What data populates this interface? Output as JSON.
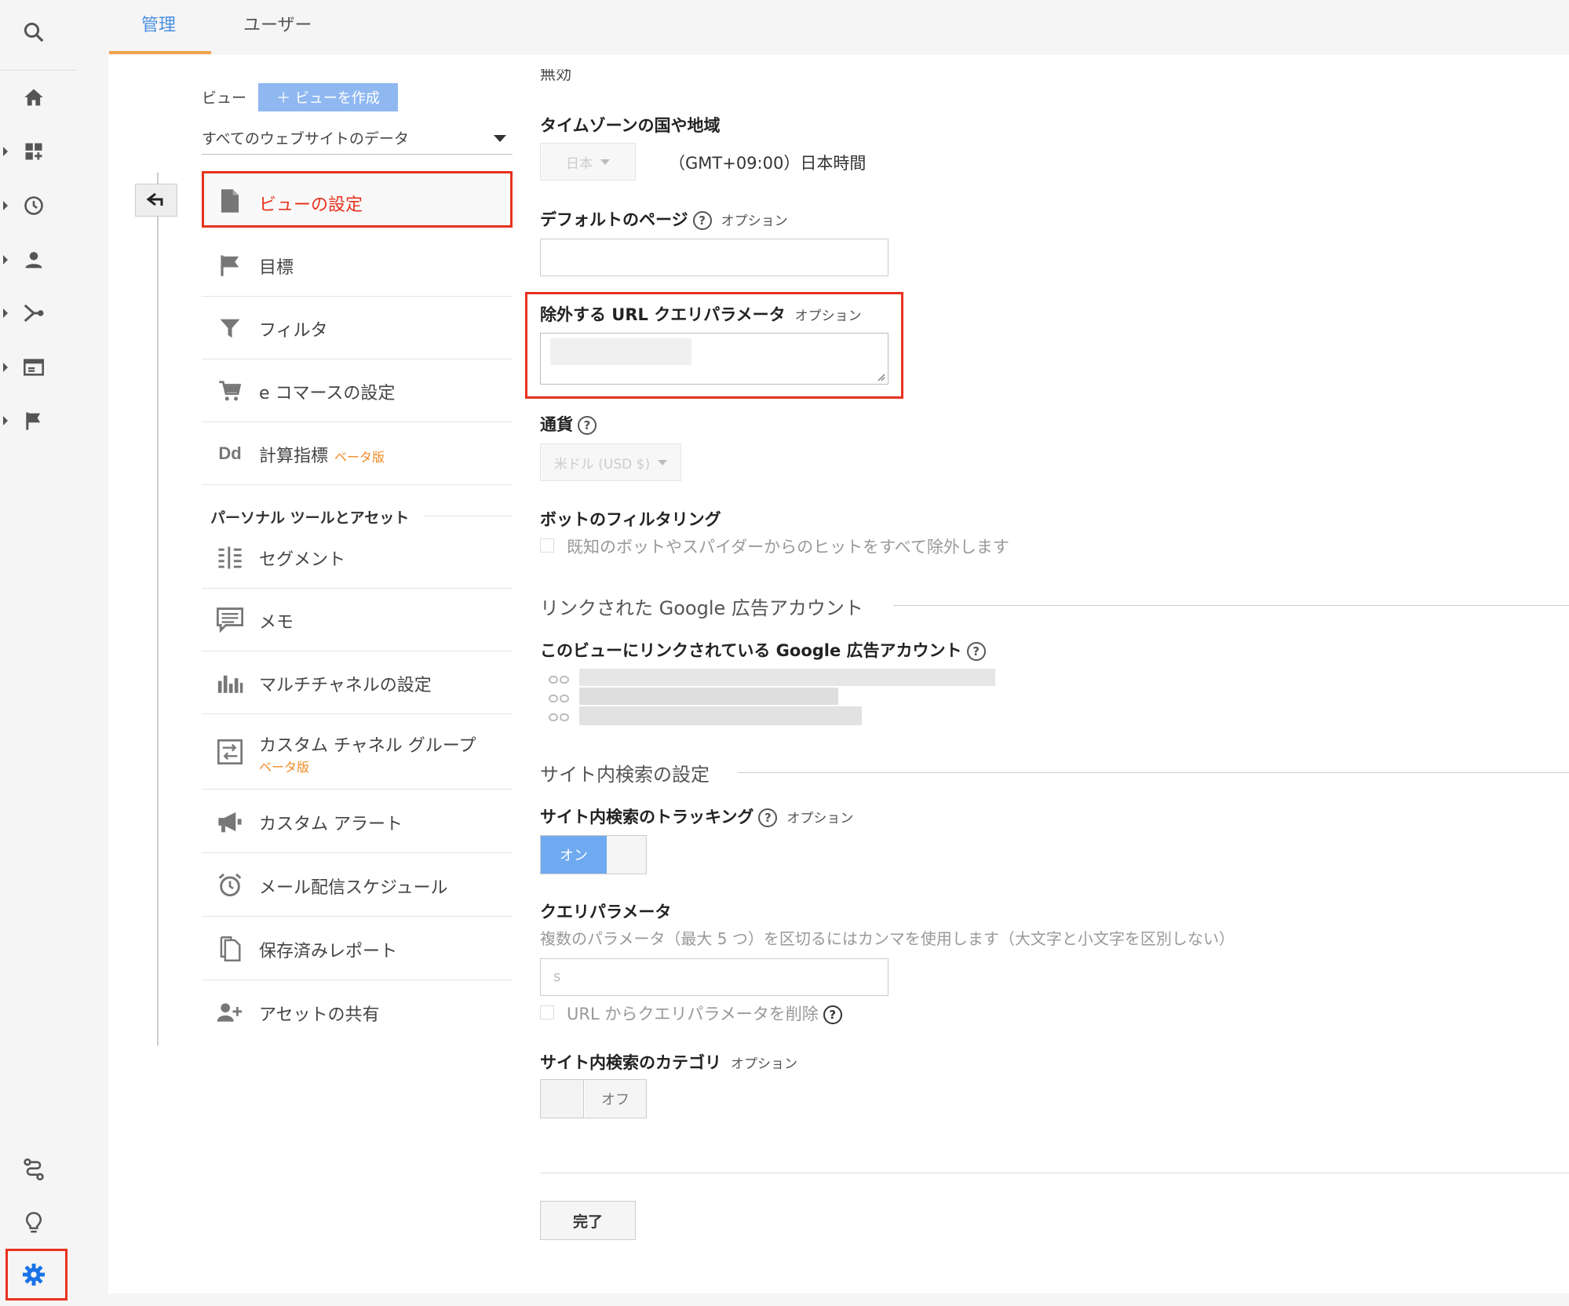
{
  "tabs": {
    "admin": "管理",
    "user": "ユーザー"
  },
  "nav": {
    "view_label": "ビュー",
    "create_view_button": "＋ ビューを作成",
    "view_select_value": "すべてのウェブサイトのデータ",
    "items": [
      {
        "label": "ビューの設定",
        "icon": "document-icon",
        "active": true
      },
      {
        "label": "目標",
        "icon": "flag-icon"
      },
      {
        "label": "フィルタ",
        "icon": "filter-icon"
      },
      {
        "label": "e コマースの設定",
        "icon": "cart-icon"
      },
      {
        "label": "計算指標",
        "icon": "dd-icon",
        "badge": "ベータ版"
      }
    ],
    "section_heading": "パーソナル ツールとアセット",
    "tools": [
      {
        "label": "セグメント",
        "icon": "segment-icon"
      },
      {
        "label": "メモ",
        "icon": "comment-icon"
      },
      {
        "label": "マルチチャネルの設定",
        "icon": "bar-chart-icon"
      },
      {
        "label": "カスタム チャネル グループ",
        "icon": "channel-group-icon",
        "badge": "ベータ版"
      },
      {
        "label": "カスタム アラート",
        "icon": "megaphone-icon"
      },
      {
        "label": "メール配信スケジュール",
        "icon": "alarm-clock-icon"
      },
      {
        "label": "保存済みレポート",
        "icon": "saved-report-icon"
      },
      {
        "label": "アセットの共有",
        "icon": "share-user-icon"
      }
    ]
  },
  "form": {
    "top_cut_text": "無効",
    "timezone": {
      "label": "タイムゾーンの国や地域",
      "country": "日本",
      "zone": "（GMT+09:00）日本時間"
    },
    "default_page": {
      "label": "デフォルトのページ",
      "optional": "オプション",
      "value": ""
    },
    "exclude_params": {
      "label": "除外する URL クエリパラメータ",
      "optional": "オプション"
    },
    "currency": {
      "label": "通貨",
      "value": "米ドル (USD $)"
    },
    "bot_filtering": {
      "label": "ボットのフィルタリング",
      "checkbox_label": "既知のボットやスパイダーからのヒットをすべて除外します"
    },
    "google_ads": {
      "section_title": "リンクされた Google 広告アカウント",
      "label": "このビューにリンクされている Google 広告アカウント"
    },
    "site_search": {
      "section_title": "サイト内検索の設定",
      "tracking_label": "サイト内検索のトラッキング",
      "optional": "オプション",
      "tracking_toggle": "オン",
      "query_param_label": "クエリパラメータ",
      "query_param_help": "複数のパラメータ（最大 5 つ）を区切るにはカンマを使用します（大文字と小文字を区別しない）",
      "query_param_value": "s",
      "remove_param_label": "URL からクエリパラメータを削除",
      "category_label": "サイト内検索のカテゴリ",
      "category_toggle": "オフ"
    },
    "done_button": "完了"
  },
  "colors": {
    "accent": "#4a90e2",
    "highlight": "#e8321e",
    "beta": "#f08a24",
    "tab_underline": "#f0a24b"
  }
}
